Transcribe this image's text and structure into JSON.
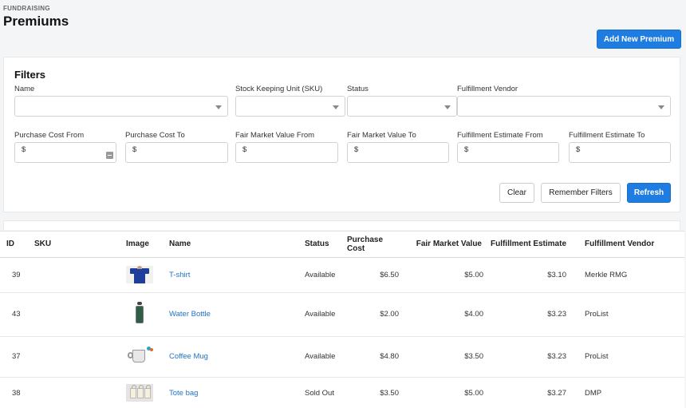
{
  "header": {
    "section": "FUNDRAISING",
    "title": "Premiums",
    "add_button": "Add New Premium"
  },
  "filters": {
    "title": "Filters",
    "fields": {
      "name": {
        "label": "Name",
        "value": ""
      },
      "sku": {
        "label": "Stock Keeping Unit (SKU)",
        "value": ""
      },
      "status": {
        "label": "Status",
        "value": ""
      },
      "vendor": {
        "label": "Fulfillment Vendor",
        "value": ""
      },
      "pc_from": {
        "label": "Purchase Cost From",
        "prefix": "$"
      },
      "pc_to": {
        "label": "Purchase Cost To",
        "prefix": "$"
      },
      "fmv_from": {
        "label": "Fair Market Value From",
        "prefix": "$"
      },
      "fmv_to": {
        "label": "Fair Market Value To",
        "prefix": "$"
      },
      "fe_from": {
        "label": "Fulfillment Estimate From",
        "prefix": "$"
      },
      "fe_to": {
        "label": "Fulfillment Estimate To",
        "prefix": "$"
      }
    },
    "buttons": {
      "clear": "Clear",
      "remember": "Remember Filters",
      "refresh": "Refresh"
    }
  },
  "table": {
    "columns": [
      "ID",
      "SKU",
      "Image",
      "Name",
      "Status",
      "Purchase Cost",
      "Fair Market Value",
      "Fulfillment Estimate",
      "Fulfillment Vendor"
    ],
    "rows": [
      {
        "id": "39",
        "sku": "",
        "image": "tshirt-image",
        "name": "T-shirt",
        "status": "Available",
        "purchase_cost": "$6.50",
        "fair_market_value": "$5.00",
        "fulfillment_estimate": "$3.10",
        "vendor": "Merkle RMG"
      },
      {
        "id": "43",
        "sku": "",
        "image": "water-bottle-image",
        "name": "Water Bottle",
        "status": "Available",
        "purchase_cost": "$2.00",
        "fair_market_value": "$4.00",
        "fulfillment_estimate": "$3.23",
        "vendor": "ProList"
      },
      {
        "id": "37",
        "sku": "",
        "image": "coffee-mug-image",
        "name": "Coffee Mug",
        "status": "Available",
        "purchase_cost": "$4.80",
        "fair_market_value": "$3.50",
        "fulfillment_estimate": "$3.23",
        "vendor": "ProList"
      },
      {
        "id": "38",
        "sku": "",
        "image": "tote-bag-image",
        "name": "Tote bag",
        "status": "Sold Out",
        "purchase_cost": "$3.50",
        "fair_market_value": "$5.00",
        "fulfillment_estimate": "$3.27",
        "vendor": "DMP"
      }
    ]
  },
  "colors": {
    "primary": "#1f7ce0",
    "link": "#1f72c8",
    "background": "#f4f5f7"
  }
}
